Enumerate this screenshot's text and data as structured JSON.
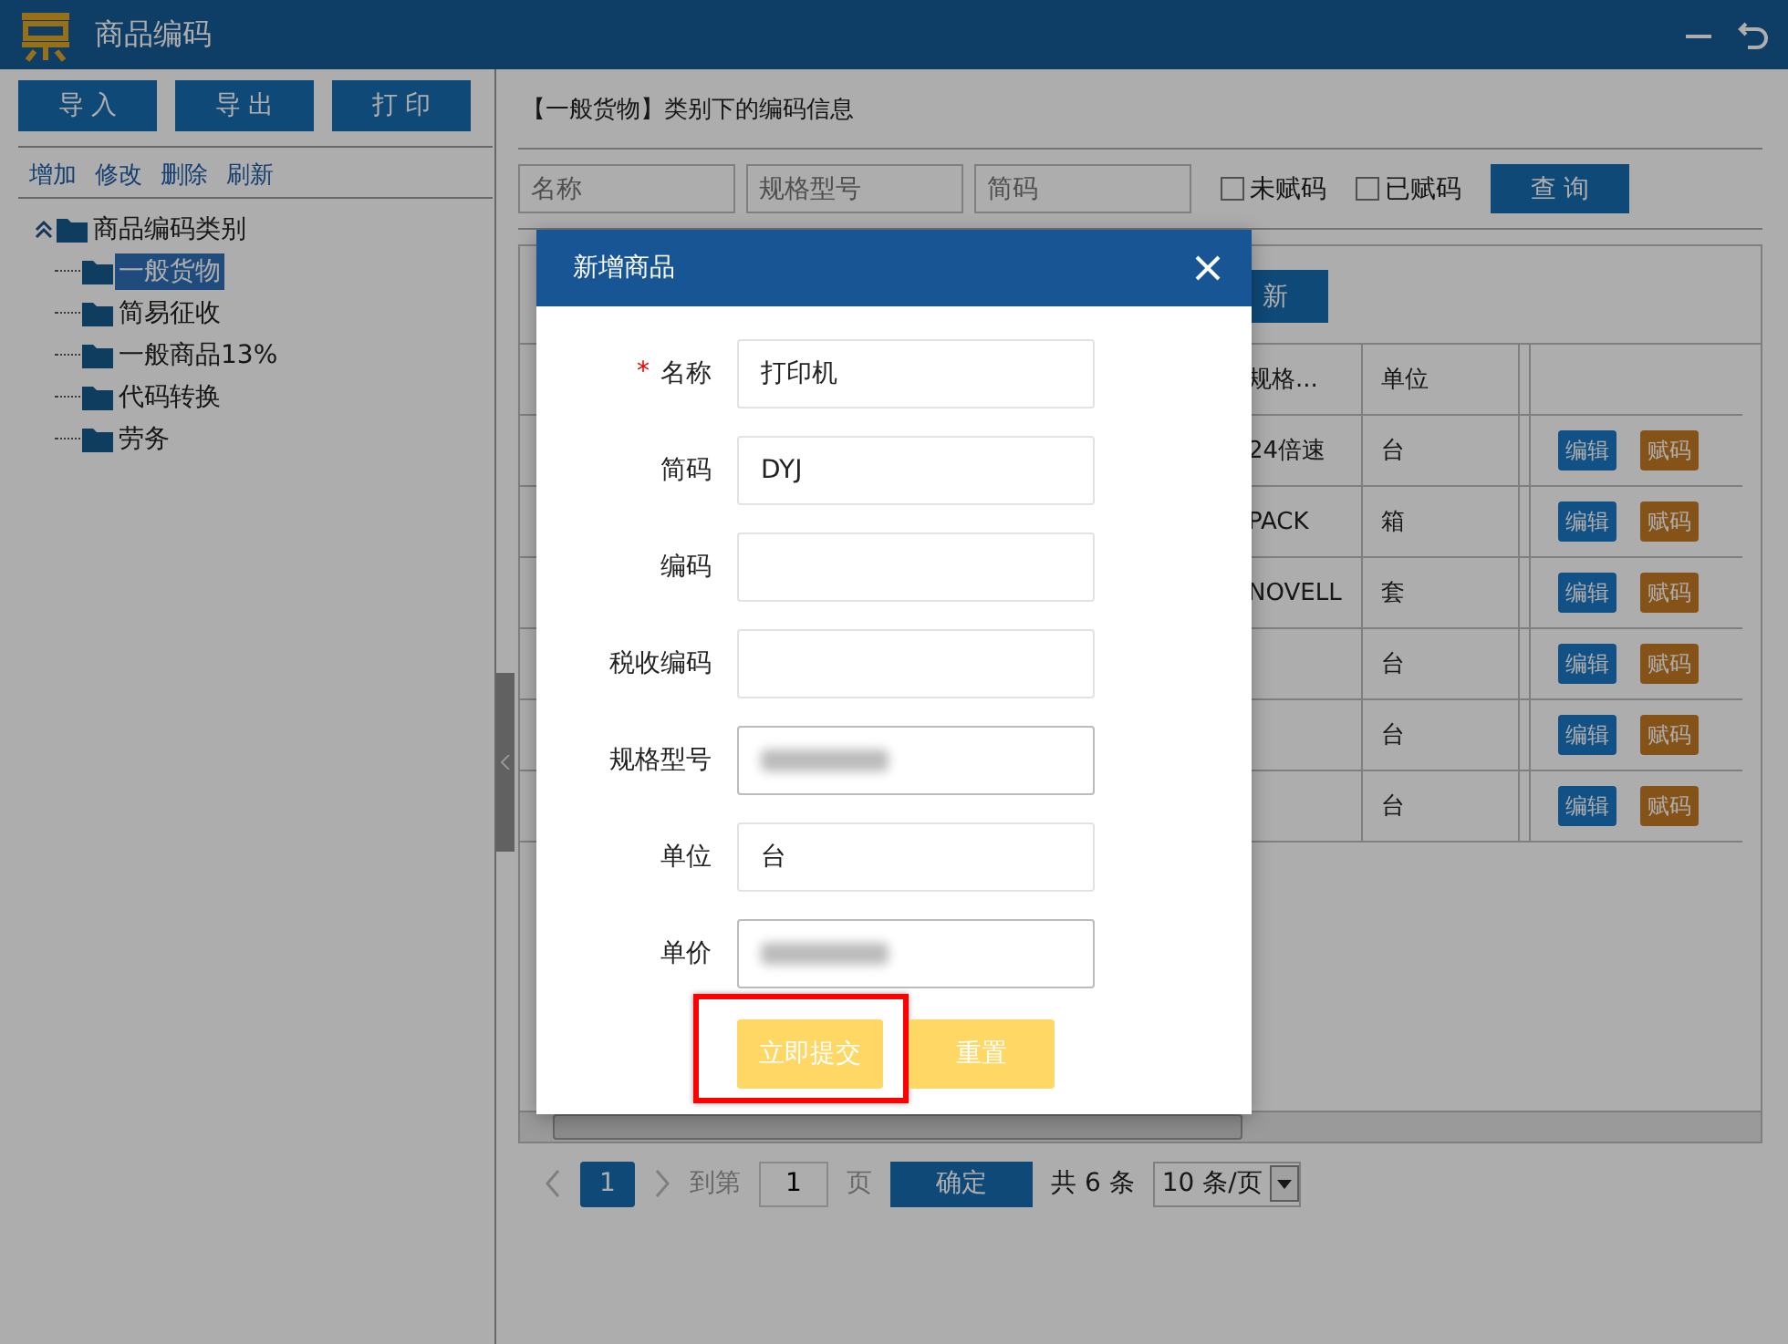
{
  "window": {
    "title": "商品编码"
  },
  "toolbar": [
    "导 入",
    "导 出",
    "打 印"
  ],
  "actions": [
    "增加",
    "修改",
    "删除",
    "刷新"
  ],
  "tree": {
    "label": "商品编码类别",
    "expanded": true,
    "children": [
      {
        "label": "一般货物",
        "selected": true
      },
      {
        "label": "简易征收",
        "selected": false
      },
      {
        "label": "一般商品13%",
        "selected": false
      },
      {
        "label": "代码转换",
        "selected": false
      },
      {
        "label": "劳务",
        "selected": false
      }
    ]
  },
  "panel": {
    "heading": "【一般货物】类别下的编码信息",
    "filters": [
      {
        "placeholder": "名称"
      },
      {
        "placeholder": "规格型号"
      },
      {
        "placeholder": "简码"
      }
    ],
    "checkboxes": [
      {
        "label": "未赋码",
        "checked": false
      },
      {
        "label": "已赋码",
        "checked": false
      }
    ],
    "search_button": "查 询",
    "refresh_button": "新"
  },
  "table": {
    "columns": [
      "规格...",
      "单位"
    ],
    "rows": [
      {
        "spec": "24倍速",
        "unit": "台",
        "actions": [
          {
            "label": "编辑",
            "kind": "edit"
          },
          {
            "label": "赋码",
            "kind": "assign"
          }
        ]
      },
      {
        "spec": "PACK",
        "unit": "箱",
        "actions": [
          {
            "label": "编辑",
            "kind": "edit"
          },
          {
            "label": "赋码",
            "kind": "assign"
          }
        ]
      },
      {
        "spec": "NOVELL",
        "unit": "套",
        "actions": [
          {
            "label": "编辑",
            "kind": "edit"
          },
          {
            "label": "赋码",
            "kind": "assign"
          }
        ]
      },
      {
        "spec": "",
        "unit": "台",
        "actions": [
          {
            "label": "编辑",
            "kind": "edit"
          },
          {
            "label": "赋码",
            "kind": "assign"
          }
        ]
      },
      {
        "spec": "",
        "unit": "台",
        "actions": [
          {
            "label": "编辑",
            "kind": "edit"
          },
          {
            "label": "赋码",
            "kind": "assign"
          }
        ]
      },
      {
        "spec": "",
        "unit": "台",
        "actions": [
          {
            "label": "编辑",
            "kind": "edit"
          },
          {
            "label": "赋码",
            "kind": "assign"
          }
        ]
      }
    ]
  },
  "pagination": {
    "pages": [
      {
        "label": "1",
        "selected": true
      }
    ],
    "goto_label": "到第",
    "goto_value": "1",
    "page_unit": "页",
    "confirm": "确定",
    "total": "共 6 条",
    "page_size": "10 条/页"
  },
  "dialog": {
    "title": "新增商品",
    "fields": [
      {
        "label": "名称",
        "required_mark": "*",
        "value": "打印机",
        "kind": "text"
      },
      {
        "label": "简码",
        "value": "DYJ",
        "kind": "text"
      },
      {
        "label": "编码",
        "kind": "text"
      },
      {
        "label": "税收编码",
        "kind": "text"
      },
      {
        "label": "规格型号",
        "kind": "blurred"
      },
      {
        "label": "单位",
        "value": "台",
        "kind": "text"
      },
      {
        "label": "单价",
        "kind": "blurred"
      }
    ],
    "buttons": [
      {
        "label": "立即提交",
        "highlighted": true
      },
      {
        "label": "重置",
        "highlighted": false
      }
    ]
  }
}
